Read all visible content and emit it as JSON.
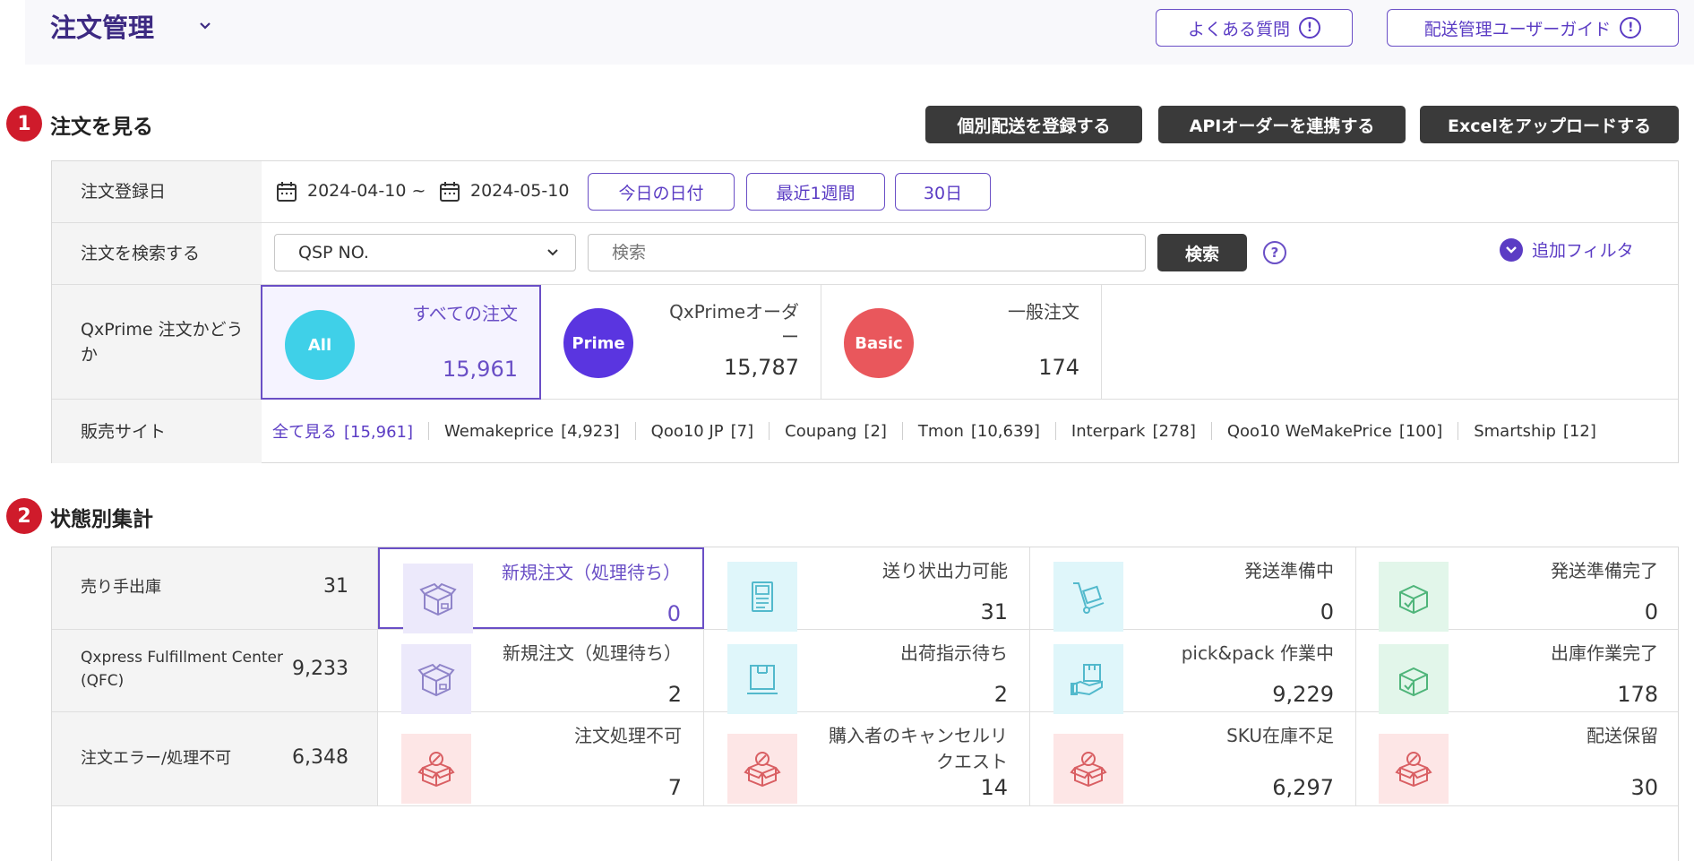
{
  "header": {
    "title": "注文管理",
    "faq_label": "よくある質問",
    "guide_label": "配送管理ユーザーガイド"
  },
  "section1": {
    "number": "1",
    "title": "注文を見る",
    "btn_individual": "個別配送を登録する",
    "btn_api": "APIオーダーを連携する",
    "btn_excel": "Excelをアップロードする"
  },
  "filters": {
    "date_label": "注文登録日",
    "date_from": "2024-04-10 ~",
    "date_to": "2024-05-10",
    "btn_today": "今日の日付",
    "btn_week": "最近1週間",
    "btn_30": "30日",
    "search_label": "注文を検索する",
    "search_select": "QSP NO.",
    "search_placeholder": "検索",
    "search_btn": "検索",
    "add_filter": "追加フィルタ",
    "prime_label": "QxPrime 注文かどうか",
    "site_label": "販売サイト"
  },
  "order_types": [
    {
      "badge": "All",
      "label": "すべての注文",
      "count": "15,961",
      "color": "#3fd0e8"
    },
    {
      "badge": "Prime",
      "label": "QxPrimeオーダー",
      "count": "15,787",
      "color": "#5a35e0"
    },
    {
      "badge": "Basic",
      "label": "一般注文",
      "count": "174",
      "color": "#e9575c"
    }
  ],
  "sites": [
    {
      "name": "全て見る",
      "count": "[15,961]"
    },
    {
      "name": "Wemakeprice",
      "count": "[4,923]"
    },
    {
      "name": "Qoo10 JP",
      "count": "[7]"
    },
    {
      "name": "Coupang",
      "count": "[2]"
    },
    {
      "name": "Tmon",
      "count": "[10,639]"
    },
    {
      "name": "Interpark",
      "count": "[278]"
    },
    {
      "name": "Qoo10 WeMakePrice",
      "count": "[100]"
    },
    {
      "name": "Smartship",
      "count": "[12]"
    }
  ],
  "section2": {
    "number": "2",
    "title": "状態別集計"
  },
  "status_rows": [
    {
      "label": "売り手出庫",
      "total": "31",
      "cells": [
        {
          "label": "新規注文（処理待ち）",
          "count": "0",
          "icon": "box-open-icon",
          "bg": "#ece9fb"
        },
        {
          "label": "送り状出力可能",
          "count": "31",
          "icon": "printer-icon",
          "bg": "#dff6fa"
        },
        {
          "label": "発送準備中",
          "count": "0",
          "icon": "hand-truck-icon",
          "bg": "#dff6fa"
        },
        {
          "label": "発送準備完了",
          "count": "0",
          "icon": "box-check-icon",
          "bg": "#e2f6ea"
        }
      ]
    },
    {
      "label": "Qxpress Fulfillment Center (QFC)",
      "total": "9,233",
      "cells": [
        {
          "label": "新規注文（処理待ち）",
          "count": "2",
          "icon": "box-open-icon",
          "bg": "#ece9fb"
        },
        {
          "label": "出荷指示待ち",
          "count": "2",
          "icon": "monitor-box-icon",
          "bg": "#dff6fa"
        },
        {
          "label": "pick&pack 作業中",
          "count": "9,229",
          "icon": "hand-box-icon",
          "bg": "#dff6fa"
        },
        {
          "label": "出庫作業完了",
          "count": "178",
          "icon": "box-check-icon",
          "bg": "#e2f6ea"
        }
      ]
    },
    {
      "label": "注文エラー/処理不可",
      "total": "6,348",
      "cells": [
        {
          "label": "注文処理不可",
          "count": "7",
          "icon": "box-error-icon",
          "bg": "#fde6e6"
        },
        {
          "label": "購入者のキャンセルリクエスト",
          "count": "14",
          "icon": "box-error-icon",
          "bg": "#fde6e6"
        },
        {
          "label": "SKU在庫不足",
          "count": "6,297",
          "icon": "box-error-icon",
          "bg": "#fde6e6"
        },
        {
          "label": "配送保留",
          "count": "30",
          "icon": "box-error-icon",
          "bg": "#fde6e6"
        }
      ]
    }
  ]
}
